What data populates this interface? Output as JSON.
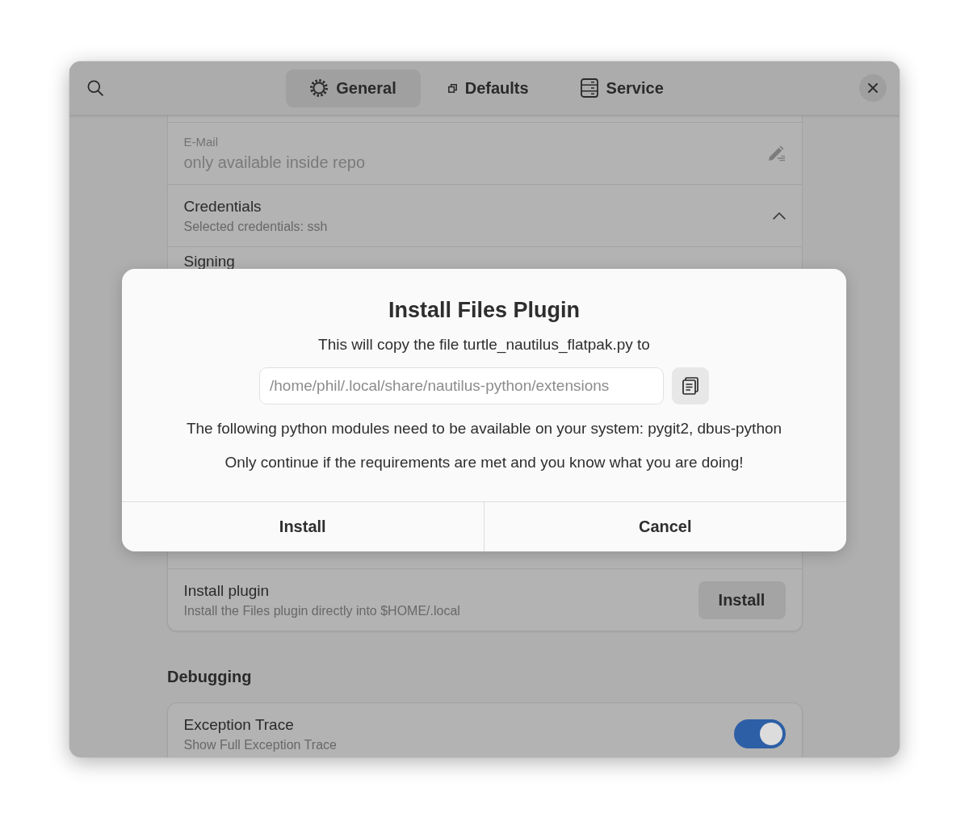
{
  "header": {
    "tabs": [
      {
        "label": "General",
        "selected": true
      },
      {
        "label": "Defaults",
        "selected": false
      },
      {
        "label": "Service",
        "selected": false
      }
    ]
  },
  "preferences": {
    "upper_rows": [
      {
        "kind": "entry",
        "label": "E-Mail",
        "value": "only available inside repo",
        "disabled": true
      },
      {
        "kind": "expander",
        "title": "Credentials",
        "subtitle": "Selected credentials: ssh",
        "expanded": true
      },
      {
        "kind": "plain",
        "title": "Signing"
      }
    ],
    "lower_rows": [
      {
        "kind": "button",
        "title": "Install plugin",
        "subtitle": "Install the Files plugin directly into $HOME/.local",
        "button": "Install"
      }
    ]
  },
  "debugging": {
    "heading": "Debugging",
    "rows": [
      {
        "kind": "switch",
        "title": "Exception Trace",
        "subtitle": "Show Full Exception Trace",
        "on": true
      }
    ]
  },
  "dialog": {
    "title": "Install Files Plugin",
    "message": "This will copy the file turtle_nautilus_flatpak.py to",
    "path_field": {
      "value": "/home/phil/.local/share/nautilus-python/extensions"
    },
    "notes": [
      "The following python modules need to be available on your system: pygit2, dbus-python",
      "Only continue if the requirements are met and you know what you are doing!"
    ],
    "buttons": [
      "Install",
      "Cancel"
    ]
  }
}
